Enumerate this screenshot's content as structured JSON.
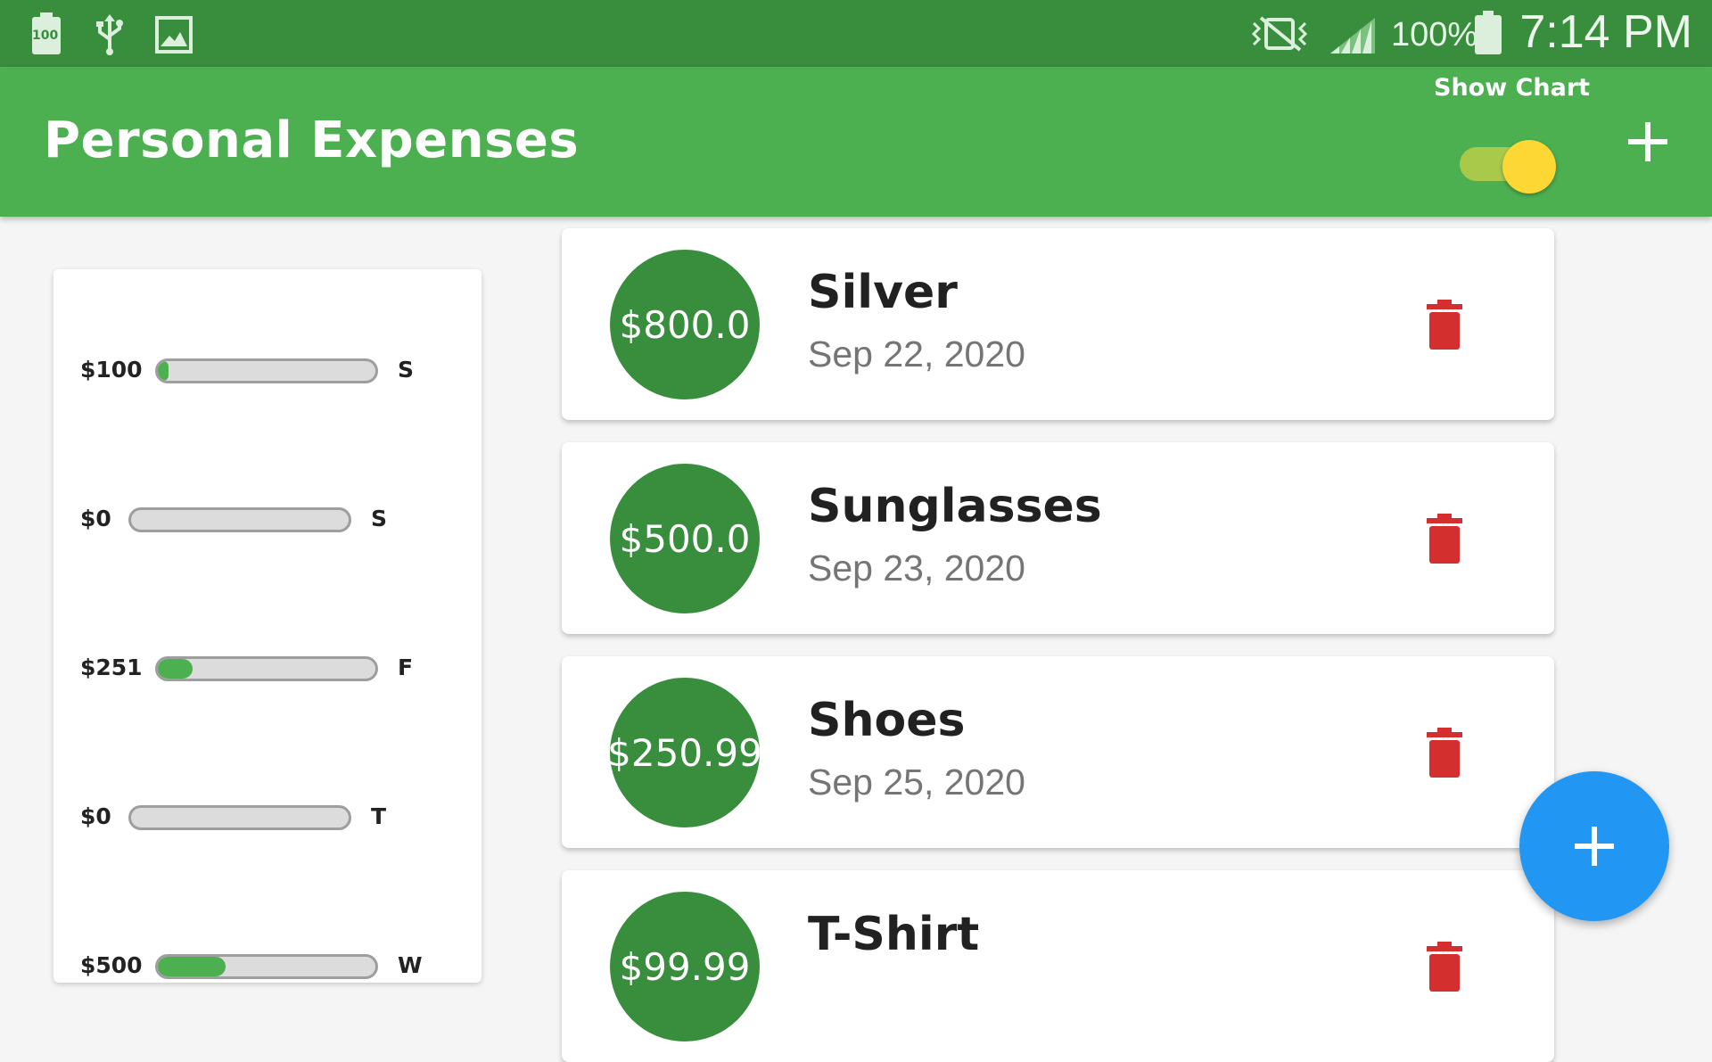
{
  "status_bar": {
    "battery_badge": "100",
    "battery_percent": "100%",
    "time": "7:14 PM",
    "icons": [
      "battery-full-icon",
      "usb-icon",
      "image-icon",
      "vibrate-mute-icon",
      "signal-icon",
      "battery-icon"
    ]
  },
  "app_bar": {
    "title": "Personal Expenses",
    "show_chart_label": "Show Chart",
    "show_chart_on": true,
    "add_icon": "plus-icon"
  },
  "chart": {
    "bars": [
      {
        "amount": "$100",
        "day": "S",
        "fraction": 0.05
      },
      {
        "amount": "$0",
        "day": "S",
        "fraction": 0
      },
      {
        "amount": "$251",
        "day": "F",
        "fraction": 0.16
      },
      {
        "amount": "$0",
        "day": "T",
        "fraction": 0
      },
      {
        "amount": "$500",
        "day": "W",
        "fraction": 0.31
      }
    ]
  },
  "transactions": [
    {
      "amount": "$800.0",
      "title": "Silver",
      "date": "Sep 22, 2020"
    },
    {
      "amount": "$500.0",
      "title": "Sunglasses",
      "date": "Sep 23, 2020"
    },
    {
      "amount": "$250.99",
      "title": "Shoes",
      "date": "Sep 25, 2020"
    },
    {
      "amount": "$99.99",
      "title": "T-Shirt",
      "date": ""
    }
  ],
  "fab": {
    "icon": "plus-icon"
  },
  "colors": {
    "primary": "#4caf50",
    "primary_dark": "#388e3c",
    "accent": "#fdd835",
    "fab": "#2196f3",
    "delete": "#d32f2f"
  }
}
